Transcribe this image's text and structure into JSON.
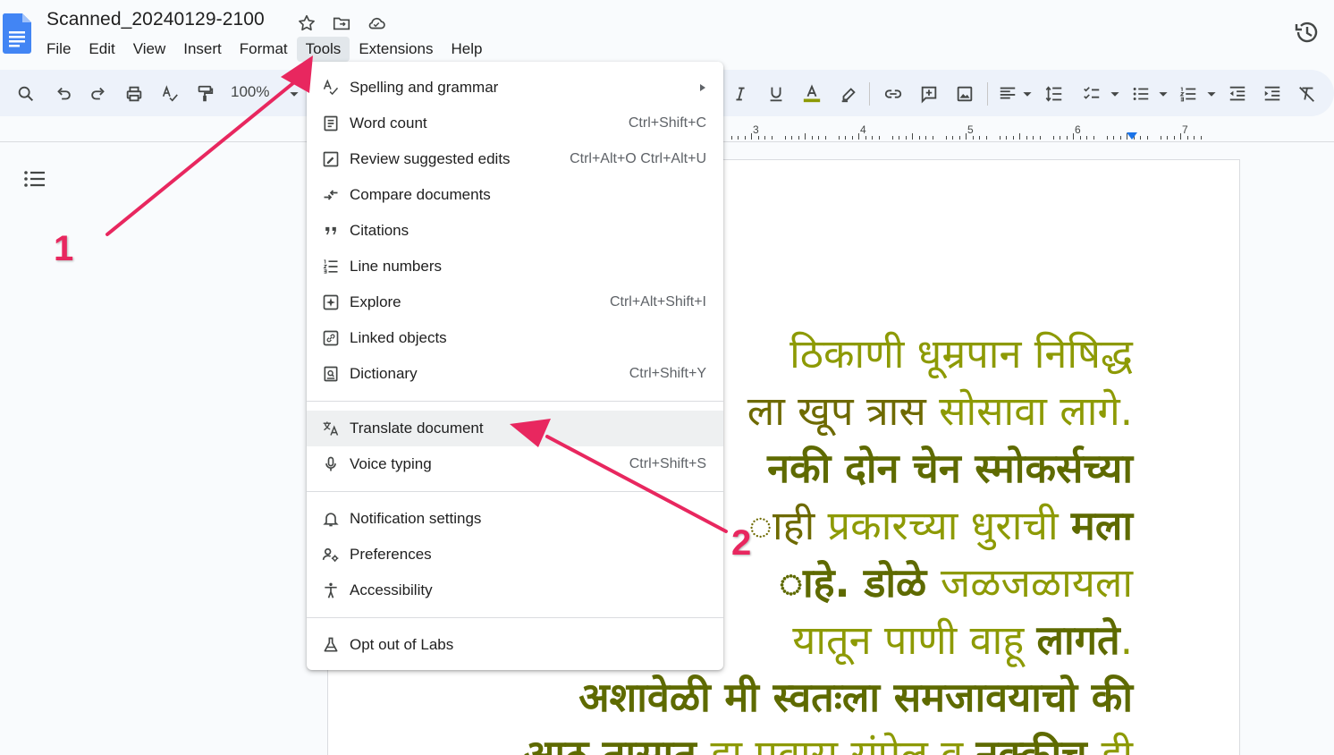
{
  "document": {
    "title": "Scanned_20240129-2100"
  },
  "menubar": {
    "items": [
      "File",
      "Edit",
      "View",
      "Insert",
      "Format",
      "Tools",
      "Extensions",
      "Help"
    ],
    "active": "Tools"
  },
  "toolbar": {
    "zoom": "100%",
    "icons": [
      "search-icon",
      "undo-icon",
      "redo-icon",
      "print-icon",
      "spellcheck-icon",
      "paint-format-icon",
      "zoom-dropdown",
      "italic-icon",
      "underline-icon",
      "text-color-icon",
      "highlight-icon",
      "link-icon",
      "comment-icon",
      "image-icon",
      "align-icon",
      "line-spacing-icon",
      "checklist-icon",
      "bulleted-list-icon",
      "numbered-list-icon",
      "decrease-indent-icon",
      "increase-indent-icon",
      "clear-formatting-icon"
    ],
    "colors": {
      "background": "#edf2fa",
      "text_color_underline": "#8d9a05"
    }
  },
  "ruler": {
    "numbers": [
      "3",
      "4",
      "5",
      "6",
      "7"
    ]
  },
  "tools_menu": {
    "items": [
      {
        "label": "Spelling and grammar",
        "shortcut": "",
        "icon": "spelling-icon",
        "submenu": true
      },
      {
        "label": "Word count",
        "shortcut": "Ctrl+Shift+C",
        "icon": "word-count-icon"
      },
      {
        "label": "Review suggested edits",
        "shortcut": "Ctrl+Alt+O Ctrl+Alt+U",
        "icon": "review-edits-icon"
      },
      {
        "label": "Compare documents",
        "shortcut": "",
        "icon": "compare-icon"
      },
      {
        "label": "Citations",
        "shortcut": "",
        "icon": "citations-icon"
      },
      {
        "label": "Line numbers",
        "shortcut": "",
        "icon": "line-numbers-icon"
      },
      {
        "label": "Explore",
        "shortcut": "Ctrl+Alt+Shift+I",
        "icon": "explore-icon"
      },
      {
        "label": "Linked objects",
        "shortcut": "",
        "icon": "linked-objects-icon"
      },
      {
        "label": "Dictionary",
        "shortcut": "Ctrl+Shift+Y",
        "icon": "dictionary-icon"
      },
      {
        "label": "Translate document",
        "shortcut": "",
        "icon": "translate-icon",
        "highlighted": true
      },
      {
        "label": "Voice typing",
        "shortcut": "Ctrl+Shift+S",
        "icon": "microphone-icon"
      },
      {
        "label": "Notification settings",
        "shortcut": "",
        "icon": "bell-icon"
      },
      {
        "label": "Preferences",
        "shortcut": "",
        "icon": "preferences-icon"
      },
      {
        "label": "Accessibility",
        "shortcut": "",
        "icon": "accessibility-icon"
      },
      {
        "label": "Opt out of Labs",
        "shortcut": "",
        "icon": "labs-flask-icon"
      }
    ]
  },
  "page_text": {
    "lines": [
      {
        "segments": [
          {
            "t": "ठिकाणी धूम्रपान निषिद्ध",
            "s": "g"
          }
        ]
      },
      {
        "segments": [
          {
            "t": "ला खूप त्रास ",
            "s": "n"
          },
          {
            "t": "सोसावा लागे.",
            "s": "g"
          }
        ]
      },
      {
        "segments": [
          {
            "t": "नकी दोन चेन स्मोकर्सच्या",
            "s": "b"
          }
        ]
      },
      {
        "segments": [
          {
            "t": "ाही ",
            "s": "n"
          },
          {
            "t": "प्रकारच्या धुराची ",
            "s": "g"
          },
          {
            "t": "मला",
            "s": "b"
          }
        ]
      },
      {
        "segments": [
          {
            "t": "ाहे. डोळे ",
            "s": "b"
          },
          {
            "t": "जळजळायला",
            "s": "g"
          }
        ]
      },
      {
        "segments": [
          {
            "t": "यातून पाणी वाहू ",
            "s": "g"
          },
          {
            "t": "लागते",
            "s": "b"
          },
          {
            "t": ".",
            "s": "g"
          }
        ]
      },
      {
        "segments": [
          {
            "t": "अशावेळी मी स्वतःला समजावयाचो की",
            "s": "b"
          }
        ]
      },
      {
        "segments": [
          {
            "t": "आठ तासात ",
            "s": "b"
          },
          {
            "t": "हा प्रवास संपेल व ",
            "s": "g"
          },
          {
            "t": "नक्कीच ",
            "s": "b"
          },
          {
            "t": "ही",
            "s": "g"
          }
        ]
      }
    ]
  },
  "annotations": {
    "labels": [
      "1",
      "2"
    ],
    "color": "#e8275f"
  }
}
